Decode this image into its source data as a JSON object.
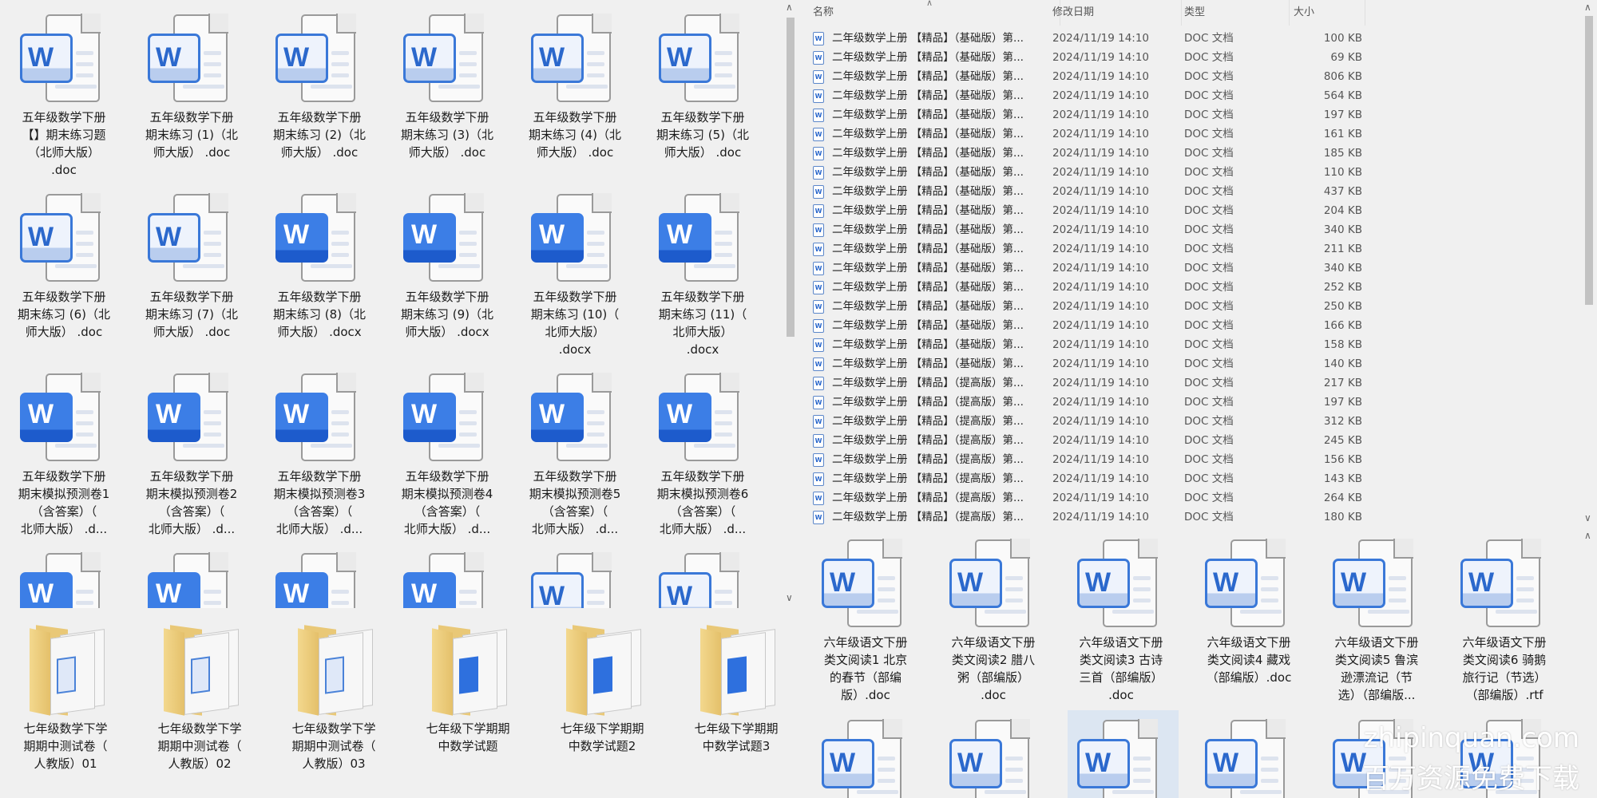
{
  "left_pane": {
    "files": [
      {
        "label": "五年级数学下册\n【】期末练习题\n（北师大版）\n.doc",
        "style": "light"
      },
      {
        "label": "五年级数学下册\n期末练习 (1)（北\n师大版） .doc",
        "style": "light"
      },
      {
        "label": "五年级数学下册\n期末练习 (2)（北\n师大版） .doc",
        "style": "light"
      },
      {
        "label": "五年级数学下册\n期末练习 (3)（北\n师大版） .doc",
        "style": "light"
      },
      {
        "label": "五年级数学下册\n期末练习 (4)（北\n师大版） .doc",
        "style": "light"
      },
      {
        "label": "五年级数学下册\n期末练习 (5)（北\n师大版） .doc",
        "style": "light"
      },
      {
        "label": "五年级数学下册\n期末练习 (6)（北\n师大版） .doc",
        "style": "light"
      },
      {
        "label": "五年级数学下册\n期末练习 (7)（北\n师大版） .doc",
        "style": "light"
      },
      {
        "label": "五年级数学下册\n期末练习 (8)（北\n师大版） .docx",
        "style": "solid"
      },
      {
        "label": "五年级数学下册\n期末练习 (9)（北\n师大版） .docx",
        "style": "solid"
      },
      {
        "label": "五年级数学下册\n期末练习 (10)（\n北师大版）\n.docx",
        "style": "solid"
      },
      {
        "label": "五年级数学下册\n期末练习 (11)（\n北师大版）\n.docx",
        "style": "solid"
      },
      {
        "label": "五年级数学下册\n期末模拟预测卷1\n（含答案）（\n北师大版） .d...",
        "style": "solid"
      },
      {
        "label": "五年级数学下册\n期末模拟预测卷2\n（含答案）（\n北师大版） .d...",
        "style": "solid"
      },
      {
        "label": "五年级数学下册\n期末模拟预测卷3\n（含答案）（\n北师大版） .d...",
        "style": "solid"
      },
      {
        "label": "五年级数学下册\n期末模拟预测卷4\n（含答案）（\n北师大版） .d...",
        "style": "solid"
      },
      {
        "label": "五年级数学下册\n期末模拟预测卷5\n（含答案）（\n北师大版） .d...",
        "style": "solid"
      },
      {
        "label": "五年级数学下册\n期末模拟预测卷6\n（含答案）（\n北师大版） .d...",
        "style": "solid"
      },
      {
        "label": "",
        "style": "solid"
      },
      {
        "label": "",
        "style": "solid"
      },
      {
        "label": "",
        "style": "solid"
      },
      {
        "label": "",
        "style": "solid"
      },
      {
        "label": "",
        "style": "light"
      },
      {
        "label": "",
        "style": "light"
      }
    ],
    "folders": [
      {
        "label": "七年级数学下学\n期期中测试卷（\n人教版）01",
        "style": "light"
      },
      {
        "label": "七年级数学下学\n期期中测试卷（\n人教版）02",
        "style": "light"
      },
      {
        "label": "七年级数学下学\n期期中测试卷（\n人教版）03",
        "style": "light"
      },
      {
        "label": "七年级下学期期\n中数学试题",
        "style": "solid"
      },
      {
        "label": "七年级下学期期\n中数学试题2",
        "style": "solid"
      },
      {
        "label": "七年级下学期期\n中数学试题3",
        "style": "solid"
      }
    ]
  },
  "details": {
    "columns": {
      "name": "名称",
      "date": "修改日期",
      "type": "类型",
      "size": "大小"
    },
    "rows": [
      {
        "name": "二年级数学上册 【精品】（基础版）第...",
        "date": "2024/11/19 14:10",
        "type": "DOC 文档",
        "size": "100 KB"
      },
      {
        "name": "二年级数学上册 【精品】（基础版）第...",
        "date": "2024/11/19 14:10",
        "type": "DOC 文档",
        "size": "69 KB"
      },
      {
        "name": "二年级数学上册 【精品】（基础版）第...",
        "date": "2024/11/19 14:10",
        "type": "DOC 文档",
        "size": "806 KB"
      },
      {
        "name": "二年级数学上册 【精品】（基础版）第...",
        "date": "2024/11/19 14:10",
        "type": "DOC 文档",
        "size": "564 KB"
      },
      {
        "name": "二年级数学上册 【精品】（基础版）第...",
        "date": "2024/11/19 14:10",
        "type": "DOC 文档",
        "size": "197 KB"
      },
      {
        "name": "二年级数学上册 【精品】（基础版）第...",
        "date": "2024/11/19 14:10",
        "type": "DOC 文档",
        "size": "161 KB"
      },
      {
        "name": "二年级数学上册 【精品】（基础版）第...",
        "date": "2024/11/19 14:10",
        "type": "DOC 文档",
        "size": "185 KB"
      },
      {
        "name": "二年级数学上册 【精品】（基础版）第...",
        "date": "2024/11/19 14:10",
        "type": "DOC 文档",
        "size": "110 KB"
      },
      {
        "name": "二年级数学上册 【精品】（基础版）第...",
        "date": "2024/11/19 14:10",
        "type": "DOC 文档",
        "size": "437 KB"
      },
      {
        "name": "二年级数学上册 【精品】（基础版）第...",
        "date": "2024/11/19 14:10",
        "type": "DOC 文档",
        "size": "204 KB"
      },
      {
        "name": "二年级数学上册 【精品】（基础版）第...",
        "date": "2024/11/19 14:10",
        "type": "DOC 文档",
        "size": "340 KB"
      },
      {
        "name": "二年级数学上册 【精品】（基础版）第...",
        "date": "2024/11/19 14:10",
        "type": "DOC 文档",
        "size": "211 KB"
      },
      {
        "name": "二年级数学上册 【精品】（基础版）第...",
        "date": "2024/11/19 14:10",
        "type": "DOC 文档",
        "size": "340 KB"
      },
      {
        "name": "二年级数学上册 【精品】（基础版）第...",
        "date": "2024/11/19 14:10",
        "type": "DOC 文档",
        "size": "252 KB"
      },
      {
        "name": "二年级数学上册 【精品】（基础版）第...",
        "date": "2024/11/19 14:10",
        "type": "DOC 文档",
        "size": "250 KB"
      },
      {
        "name": "二年级数学上册 【精品】（基础版）第...",
        "date": "2024/11/19 14:10",
        "type": "DOC 文档",
        "size": "166 KB"
      },
      {
        "name": "二年级数学上册 【精品】（基础版）第...",
        "date": "2024/11/19 14:10",
        "type": "DOC 文档",
        "size": "158 KB"
      },
      {
        "name": "二年级数学上册 【精品】（基础版）第...",
        "date": "2024/11/19 14:10",
        "type": "DOC 文档",
        "size": "140 KB"
      },
      {
        "name": "二年级数学上册 【精品】（提高版）第...",
        "date": "2024/11/19 14:10",
        "type": "DOC 文档",
        "size": "217 KB"
      },
      {
        "name": "二年级数学上册 【精品】（提高版）第...",
        "date": "2024/11/19 14:10",
        "type": "DOC 文档",
        "size": "197 KB"
      },
      {
        "name": "二年级数学上册 【精品】（提高版）第...",
        "date": "2024/11/19 14:10",
        "type": "DOC 文档",
        "size": "312 KB"
      },
      {
        "name": "二年级数学上册 【精品】（提高版）第...",
        "date": "2024/11/19 14:10",
        "type": "DOC 文档",
        "size": "245 KB"
      },
      {
        "name": "二年级数学上册 【精品】（提高版）第...",
        "date": "2024/11/19 14:10",
        "type": "DOC 文档",
        "size": "156 KB"
      },
      {
        "name": "二年级数学上册 【精品】（提高版）第...",
        "date": "2024/11/19 14:10",
        "type": "DOC 文档",
        "size": "143 KB"
      },
      {
        "name": "二年级数学上册 【精品】（提高版）第...",
        "date": "2024/11/19 14:10",
        "type": "DOC 文档",
        "size": "264 KB"
      },
      {
        "name": "二年级数学上册 【精品】（提高版）第...",
        "date": "2024/11/19 14:10",
        "type": "DOC 文档",
        "size": "180 KB"
      }
    ]
  },
  "right_icons": {
    "files": [
      {
        "label": "六年级语文下册\n类文阅读1 北京\n的春节（部编\n版）.doc",
        "style": "light"
      },
      {
        "label": "六年级语文下册\n类文阅读2 腊八\n粥（部编版）\n.doc",
        "style": "light"
      },
      {
        "label": "六年级语文下册\n类文阅读3 古诗\n三首（部编版）\n.doc",
        "style": "light"
      },
      {
        "label": "六年级语文下册\n类文阅读4 藏戏\n（部编版）.doc",
        "style": "light"
      },
      {
        "label": "六年级语文下册\n类文阅读5 鲁滨\n逊漂流记（节\n选）（部编版...",
        "style": "light"
      },
      {
        "label": "六年级语文下册\n类文阅读6 骑鹅\n旅行记（节选）\n（部编版）.rtf",
        "style": "light"
      },
      {
        "label": "",
        "style": "light"
      },
      {
        "label": "",
        "style": "light"
      },
      {
        "label": "",
        "style": "light"
      },
      {
        "label": "",
        "style": "light"
      },
      {
        "label": "",
        "style": "light"
      },
      {
        "label": "",
        "style": "light"
      }
    ]
  },
  "watermark": {
    "line1": "zhipinquan.com",
    "line2": "百万资源免费下载"
  },
  "icons": {
    "doc": "word-doc-icon",
    "folder": "folder-icon",
    "scroll_up": "chevron-up-icon",
    "scroll_down": "chevron-down-icon"
  },
  "colors": {
    "word_blue": "#2b68cc",
    "folder": "#e9c877",
    "selection": "#dce6f2"
  }
}
